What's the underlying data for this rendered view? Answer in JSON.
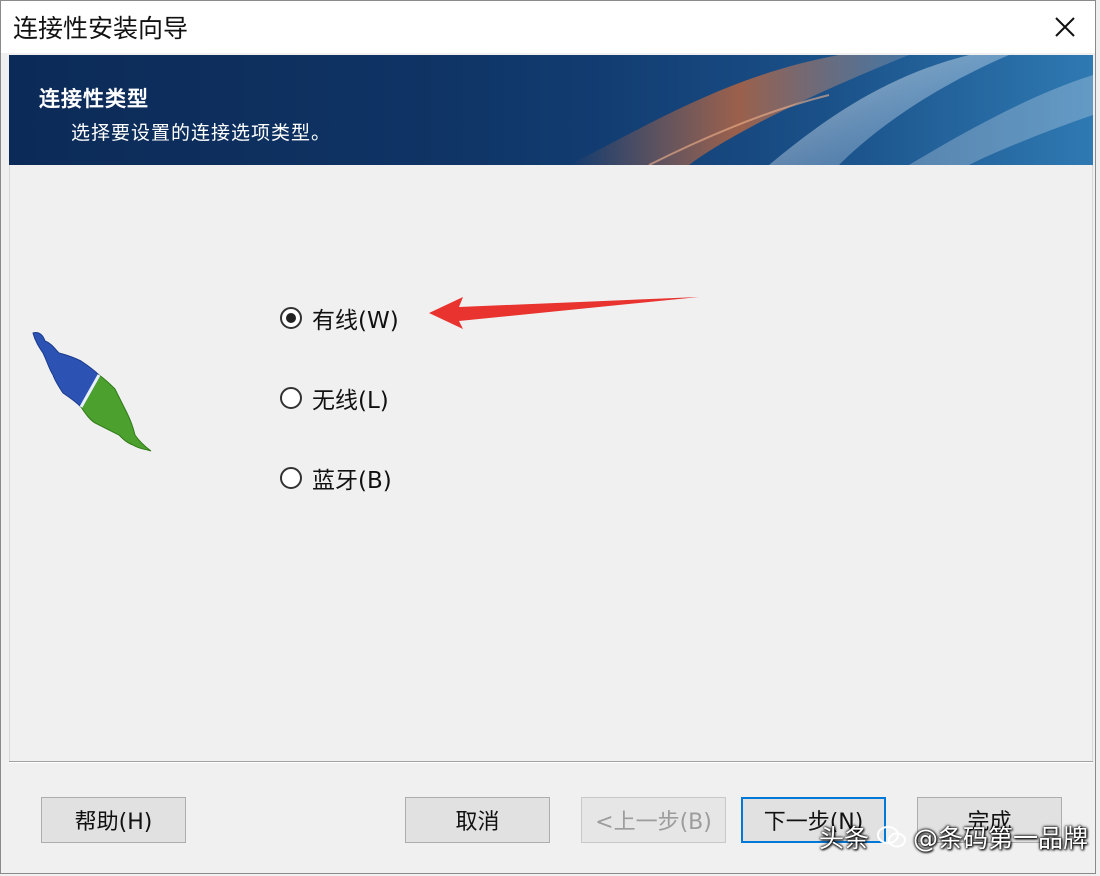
{
  "window": {
    "title": "连接性安装向导",
    "close_icon": "close-icon"
  },
  "banner": {
    "title": "连接性类型",
    "subtitle": "选择要设置的连接选项类型。"
  },
  "options": [
    {
      "label": "有线(W)",
      "checked": true
    },
    {
      "label": "无线(L)",
      "checked": false
    },
    {
      "label": "蓝牙(B)",
      "checked": false
    }
  ],
  "buttons": {
    "help": "帮助(H)",
    "cancel": "取消",
    "back": "<上一步(B)",
    "next": "下一步(N)",
    "finish": "完成"
  },
  "watermark": {
    "prefix": "头条",
    "handle": "@条码第一品牌"
  },
  "colors": {
    "arrow": "#e8332f",
    "focus": "#0078d7",
    "banner_dark": "#0c2a57",
    "plug_blue": "#2c53b4",
    "plug_green": "#4ca02d"
  }
}
